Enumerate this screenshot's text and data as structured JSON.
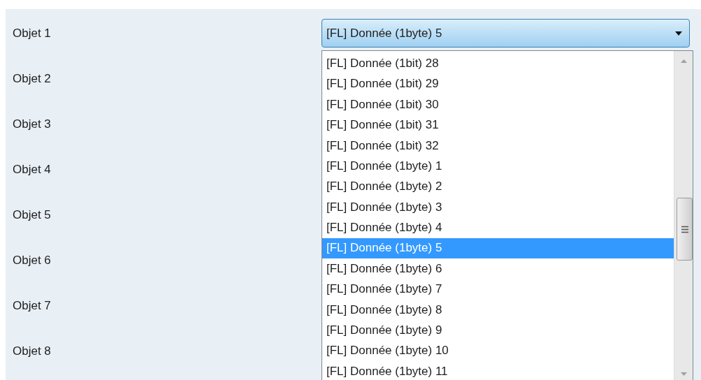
{
  "objects": [
    {
      "label": "Objet 1"
    },
    {
      "label": "Objet 2"
    },
    {
      "label": "Objet 3"
    },
    {
      "label": "Objet 4"
    },
    {
      "label": "Objet 5"
    },
    {
      "label": "Objet 6"
    },
    {
      "label": "Objet 7"
    },
    {
      "label": "Objet 8"
    }
  ],
  "dropdown": {
    "value": "[FL] Donnée (1byte) 5",
    "expanded": true,
    "items": [
      {
        "label": "[FL] Donnée (1bit) 28",
        "selected": false
      },
      {
        "label": "[FL] Donnée (1bit) 29",
        "selected": false
      },
      {
        "label": "[FL] Donnée (1bit) 30",
        "selected": false
      },
      {
        "label": "[FL] Donnée (1bit) 31",
        "selected": false
      },
      {
        "label": "[FL] Donnée (1bit) 32",
        "selected": false
      },
      {
        "label": "[FL] Donnée (1byte) 1",
        "selected": false
      },
      {
        "label": "[FL] Donnée (1byte) 2",
        "selected": false
      },
      {
        "label": "[FL] Donnée (1byte) 3",
        "selected": false
      },
      {
        "label": "[FL] Donnée (1byte) 4",
        "selected": false
      },
      {
        "label": "[FL] Donnée (1byte) 5",
        "selected": true
      },
      {
        "label": "[FL] Donnée (1byte) 6",
        "selected": false
      },
      {
        "label": "[FL] Donnée (1byte) 7",
        "selected": false
      },
      {
        "label": "[FL] Donnée (1byte) 8",
        "selected": false
      },
      {
        "label": "[FL] Donnée (1byte) 9",
        "selected": false
      },
      {
        "label": "[FL] Donnée (1byte) 10",
        "selected": false
      },
      {
        "label": "[FL] Donnée (1byte) 11",
        "selected": false
      }
    ]
  }
}
